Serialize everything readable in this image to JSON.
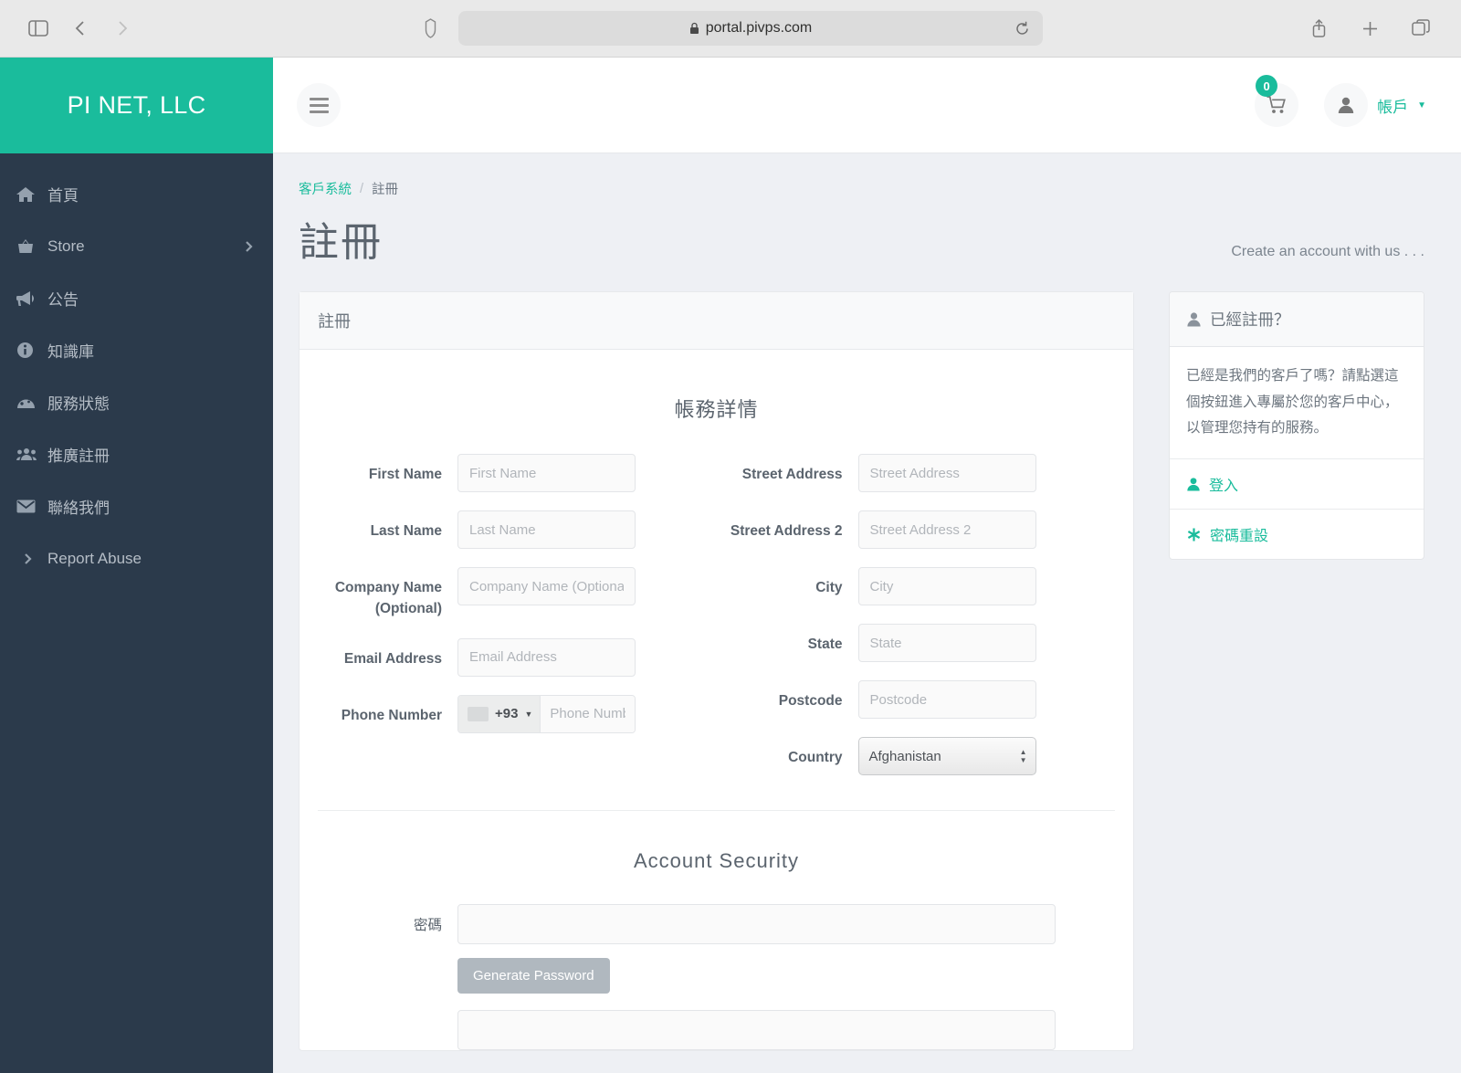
{
  "browser": {
    "url": "portal.pivps.com",
    "icons": {
      "sidebar_toggle": "sidebar-toggle-icon",
      "back": "back-arrow-icon",
      "forward": "forward-arrow-icon",
      "shield": "privacy-shield-icon",
      "lock": "lock-icon",
      "reload": "reload-icon",
      "share": "share-icon",
      "new_tab": "plus-icon",
      "tabs": "tabs-overview-icon"
    }
  },
  "sidebar": {
    "brand": "PI NET, LLC",
    "items": [
      {
        "label": "首頁",
        "icon": "home-icon",
        "caret": false
      },
      {
        "label": "Store",
        "icon": "basket-icon",
        "caret": true
      },
      {
        "label": "公告",
        "icon": "megaphone-icon",
        "caret": false
      },
      {
        "label": "知識庫",
        "icon": "info-circle-icon",
        "caret": false
      },
      {
        "label": "服務狀態",
        "icon": "gauge-icon",
        "caret": false
      },
      {
        "label": "推廣註冊",
        "icon": "users-icon",
        "caret": false
      },
      {
        "label": "聯絡我們",
        "icon": "envelope-icon",
        "caret": false
      },
      {
        "label": "Report Abuse",
        "icon": "chevron-right-icon",
        "caret": false
      }
    ]
  },
  "topbar": {
    "cart_count": "0",
    "account_label": "帳戶"
  },
  "breadcrumb": {
    "root": "客戶系統",
    "separator": "/",
    "current": "註冊"
  },
  "page": {
    "title": "註冊",
    "tagline": "Create an account with us . . ."
  },
  "panel": {
    "header": "註冊",
    "billing_section_title": "帳務詳情",
    "security_section_title": "Account Security",
    "left_fields": [
      {
        "label": "First Name",
        "placeholder": "First Name",
        "value": ""
      },
      {
        "label": "Last Name",
        "placeholder": "Last Name",
        "value": ""
      },
      {
        "label": "Company Name (Optional)",
        "placeholder": "Company Name (Optional)",
        "value": ""
      },
      {
        "label": "Email Address",
        "placeholder": "Email Address",
        "value": ""
      }
    ],
    "phone": {
      "label": "Phone Number",
      "country_code": "+93",
      "placeholder": "Phone Number",
      "value": ""
    },
    "right_fields": [
      {
        "label": "Street Address",
        "placeholder": "Street Address",
        "value": ""
      },
      {
        "label": "Street Address 2",
        "placeholder": "Street Address 2",
        "value": ""
      },
      {
        "label": "City",
        "placeholder": "City",
        "value": ""
      },
      {
        "label": "State",
        "placeholder": "State",
        "value": ""
      },
      {
        "label": "Postcode",
        "placeholder": "Postcode",
        "value": ""
      }
    ],
    "country": {
      "label": "Country",
      "selected": "Afghanistan"
    },
    "password": {
      "label": "密碼",
      "value": "",
      "generate_button": "Generate Password",
      "confirm_value": ""
    }
  },
  "side_card": {
    "header": "已經註冊？",
    "body": "已經是我們的客戶了嗎？請點選這個按鈕進入專屬於您的客戶中心，以管理您持有的服務。",
    "links": [
      {
        "label": "登入",
        "icon": "user-icon"
      },
      {
        "label": "密碼重設",
        "icon": "asterisk-icon"
      }
    ]
  },
  "colors": {
    "brand_teal": "#1abc9c",
    "sidebar_dark": "#2b3a4b",
    "page_bg": "#eef0f4"
  }
}
